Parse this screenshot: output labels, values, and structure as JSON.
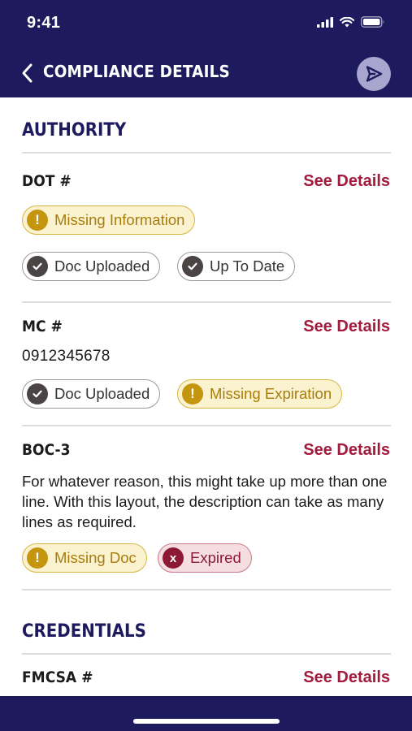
{
  "status_bar": {
    "time": "9:41"
  },
  "header": {
    "title": "COMPLIANCE DETAILS",
    "back_icon": "chevron-left-icon",
    "send_icon": "send-icon"
  },
  "colors": {
    "header_bg": "#1d1a5e",
    "link": "#a21a3c",
    "warning": "#c4950e",
    "error": "#8c1a34"
  },
  "sections": [
    {
      "title": "AUTHORITY",
      "items": [
        {
          "title": "DOT #",
          "link": "See Details",
          "chips": [
            {
              "label": "Missing Information",
              "kind": "warning"
            },
            {
              "label": "Doc Uploaded",
              "kind": "ok"
            },
            {
              "label": "Up To Date",
              "kind": "ok"
            }
          ]
        },
        {
          "title": "MC #",
          "link": "See Details",
          "value": "0912345678",
          "chips": [
            {
              "label": "Doc Uploaded",
              "kind": "ok"
            },
            {
              "label": "Missing Expiration",
              "kind": "warning"
            }
          ]
        },
        {
          "title": "BOC-3",
          "link": "See Details",
          "description": "For whatever reason, this might take up more than one line. With this layout, the description can take as many lines as required.",
          "chips": [
            {
              "label": "Missing Doc",
              "kind": "warning"
            },
            {
              "label": "Expired",
              "kind": "error"
            }
          ]
        }
      ]
    },
    {
      "title": "CREDENTIALS",
      "items": [
        {
          "title": "FMCSA #",
          "link": "See Details"
        }
      ]
    }
  ]
}
